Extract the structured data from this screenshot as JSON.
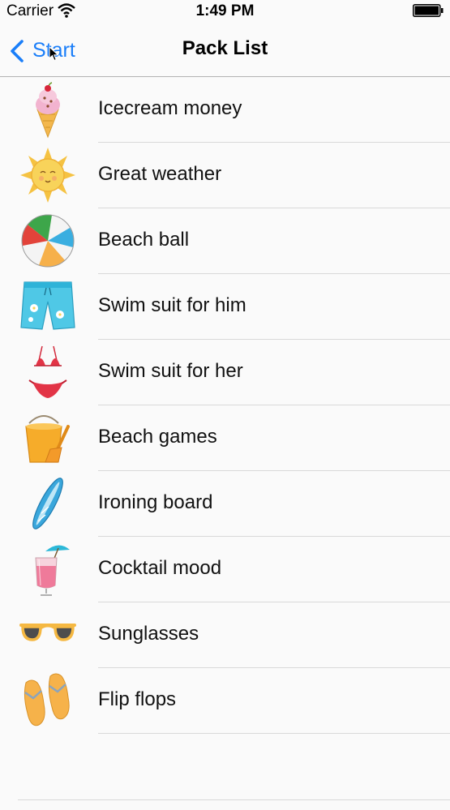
{
  "status_bar": {
    "carrier": "Carrier",
    "time": "1:49 PM"
  },
  "nav": {
    "back_label": "Start",
    "title": "Pack List",
    "accent_color": "#1a7ef9"
  },
  "items": [
    {
      "label": "Icecream money",
      "icon": "icecream-icon"
    },
    {
      "label": "Great weather",
      "icon": "sun-icon"
    },
    {
      "label": "Beach ball",
      "icon": "beach-ball-icon"
    },
    {
      "label": "Swim suit for him",
      "icon": "swim-trunks-icon"
    },
    {
      "label": "Swim suit for her",
      "icon": "bikini-icon"
    },
    {
      "label": "Beach games",
      "icon": "bucket-spade-icon"
    },
    {
      "label": "Ironing board",
      "icon": "surfboard-icon"
    },
    {
      "label": "Cocktail mood",
      "icon": "cocktail-icon"
    },
    {
      "label": "Sunglasses",
      "icon": "sunglasses-icon"
    },
    {
      "label": "Flip flops",
      "icon": "flip-flops-icon"
    }
  ]
}
